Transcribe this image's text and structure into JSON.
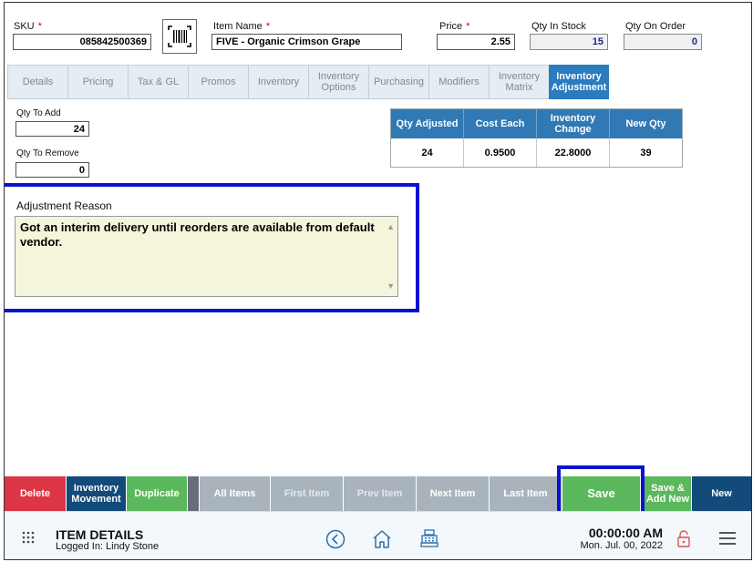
{
  "header": {
    "sku_label": "SKU",
    "sku_value": "085842500369",
    "item_name_label": "Item Name",
    "item_name_value": "FIVE - Organic Crimson Grape",
    "price_label": "Price",
    "price_value": "2.55",
    "qty_in_stock_label": "Qty In Stock",
    "qty_in_stock_value": "15",
    "qty_on_order_label": "Qty On Order",
    "qty_on_order_value": "0",
    "required_mark": "*"
  },
  "tabs": [
    {
      "label": "Details"
    },
    {
      "label": "Pricing"
    },
    {
      "label": "Tax & GL"
    },
    {
      "label": "Promos"
    },
    {
      "label": "Inventory"
    },
    {
      "label": "Inventory Options"
    },
    {
      "label": "Purchasing"
    },
    {
      "label": "Modifiers"
    },
    {
      "label": "Inventory Matrix"
    },
    {
      "label": "Inventory Adjustment",
      "active": true
    }
  ],
  "adjustment": {
    "qty_to_add_label": "Qty To Add",
    "qty_to_add_value": "24",
    "qty_to_remove_label": "Qty To Remove",
    "qty_to_remove_value": "0",
    "reason_label": "Adjustment Reason",
    "reason_text": "Got an interim delivery until reorders are available from default vendor."
  },
  "summary_table": {
    "headers": [
      "Qty Adjusted",
      "Cost Each",
      "Inventory Change",
      "New Qty"
    ],
    "row": [
      "24",
      "0.9500",
      "22.8000",
      "39"
    ]
  },
  "buttons": {
    "delete": "Delete",
    "inventory_movement": "Inventory Movement",
    "duplicate": "Duplicate",
    "all_items": "All Items",
    "first_item": "First Item",
    "prev_item": "Prev Item",
    "next_item": "Next Item",
    "last_item": "Last Item",
    "save": "Save",
    "save_add_new": "Save & Add New",
    "new": "New"
  },
  "footer": {
    "title": "ITEM DETAILS",
    "logged_in": "Logged In:  Lindy Stone",
    "time": "00:00:00 AM",
    "date": "Mon. Jul. 00, 2022"
  },
  "colors": {
    "accent_blue": "#2b7bbf",
    "highlight_border": "#0a14d0",
    "delete_red": "#dc3545",
    "save_green": "#5cb85c",
    "nav_gray": "#a9b3bc",
    "dark_blue": "#124a7a"
  },
  "icons": [
    "barcode-icon",
    "grid-menu-icon",
    "back-icon",
    "home-icon",
    "register-icon",
    "lock-icon",
    "hamburger-icon"
  ]
}
